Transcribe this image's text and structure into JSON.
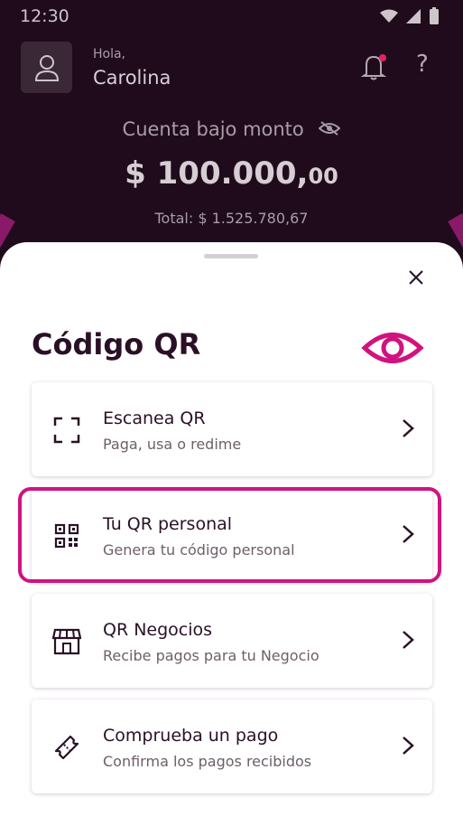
{
  "status_bar": {
    "time": "12:30"
  },
  "header": {
    "greeting": "Hola,",
    "user_name": "Carolina",
    "balance_label": "Cuenta bajo monto",
    "balance_main": "$ 100.000,",
    "balance_decimals": "00",
    "total": "Total: $ 1.525.780,67"
  },
  "sheet": {
    "title": "Código QR",
    "options": [
      {
        "title": "Escanea QR",
        "subtitle": "Paga, usa o redime",
        "icon": "scan-icon"
      },
      {
        "title": "Tu QR personal",
        "subtitle": "Genera tu código personal",
        "icon": "qr-code-icon",
        "highlighted": true
      },
      {
        "title": "QR Negocios",
        "subtitle": "Recibe pagos para tu Negocio",
        "icon": "store-icon"
      },
      {
        "title": "Comprueba un pago",
        "subtitle": "Confirma los pagos recibidos",
        "icon": "ticket-icon"
      }
    ]
  },
  "colors": {
    "header_bg": "#1f0b1c",
    "accent": "#d0137f",
    "text_dark": "#2a1026",
    "notification_dot": "#e0245e"
  }
}
